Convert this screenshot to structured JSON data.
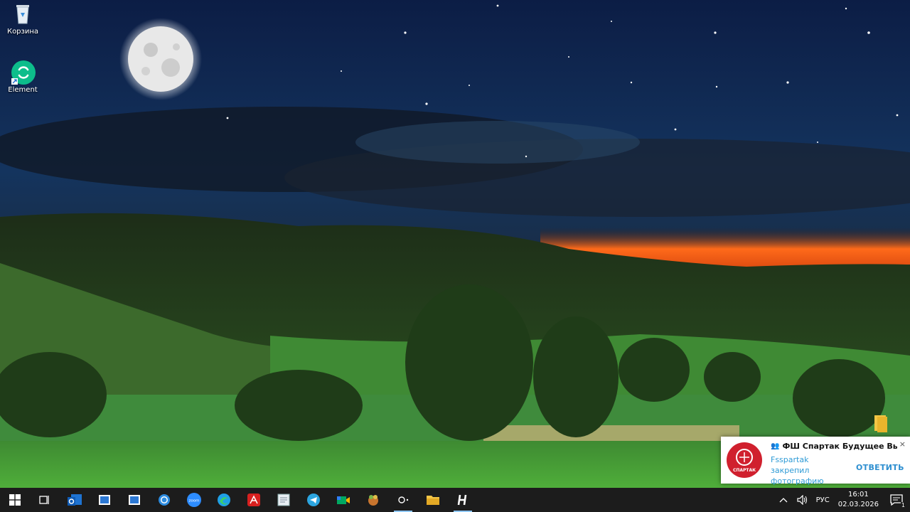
{
  "desktop": {
    "icons": [
      {
        "label": "Корзина",
        "icon": "recycle-bin-icon"
      },
      {
        "label": "Element",
        "icon": "element-app-icon"
      }
    ]
  },
  "taskbar": {
    "apps": [
      {
        "name": "start",
        "icon": "windows-logo-icon"
      },
      {
        "name": "task-view",
        "icon": "task-view-icon"
      },
      {
        "name": "outlook",
        "icon": "outlook-icon"
      },
      {
        "name": "window-app-1",
        "icon": "window-icon"
      },
      {
        "name": "window-app-2",
        "icon": "window-icon"
      },
      {
        "name": "cortana",
        "icon": "circle-ring-icon"
      },
      {
        "name": "zoom",
        "icon": "zoom-icon",
        "label": "zoom"
      },
      {
        "name": "edge",
        "icon": "edge-icon"
      },
      {
        "name": "acrobat",
        "icon": "acrobat-icon"
      },
      {
        "name": "notepad",
        "icon": "notepad-icon"
      },
      {
        "name": "telegram",
        "icon": "telegram-icon"
      },
      {
        "name": "meet",
        "icon": "video-meet-icon"
      },
      {
        "name": "game",
        "icon": "game-icon"
      },
      {
        "name": "obs",
        "icon": "obs-icon"
      },
      {
        "name": "explorer",
        "icon": "folder-icon"
      },
      {
        "name": "hotkey-app",
        "icon": "h-letter-icon"
      }
    ],
    "tray": {
      "language": "РУС",
      "time": "16:01",
      "date": "02.03.2026",
      "notification_count": "1"
    }
  },
  "notification": {
    "title": "ФШ Спартак Будущее Выбо...",
    "body": "Fsspartak закрепил фотографию",
    "reply_label": "ОТВЕТИТЬ",
    "close_glyph": "×",
    "logo_text": "СПАРТАК"
  },
  "colors": {
    "taskbar": "#1c1c1c",
    "accent": "#2e8fd0",
    "spartak_red": "#d0202e"
  }
}
